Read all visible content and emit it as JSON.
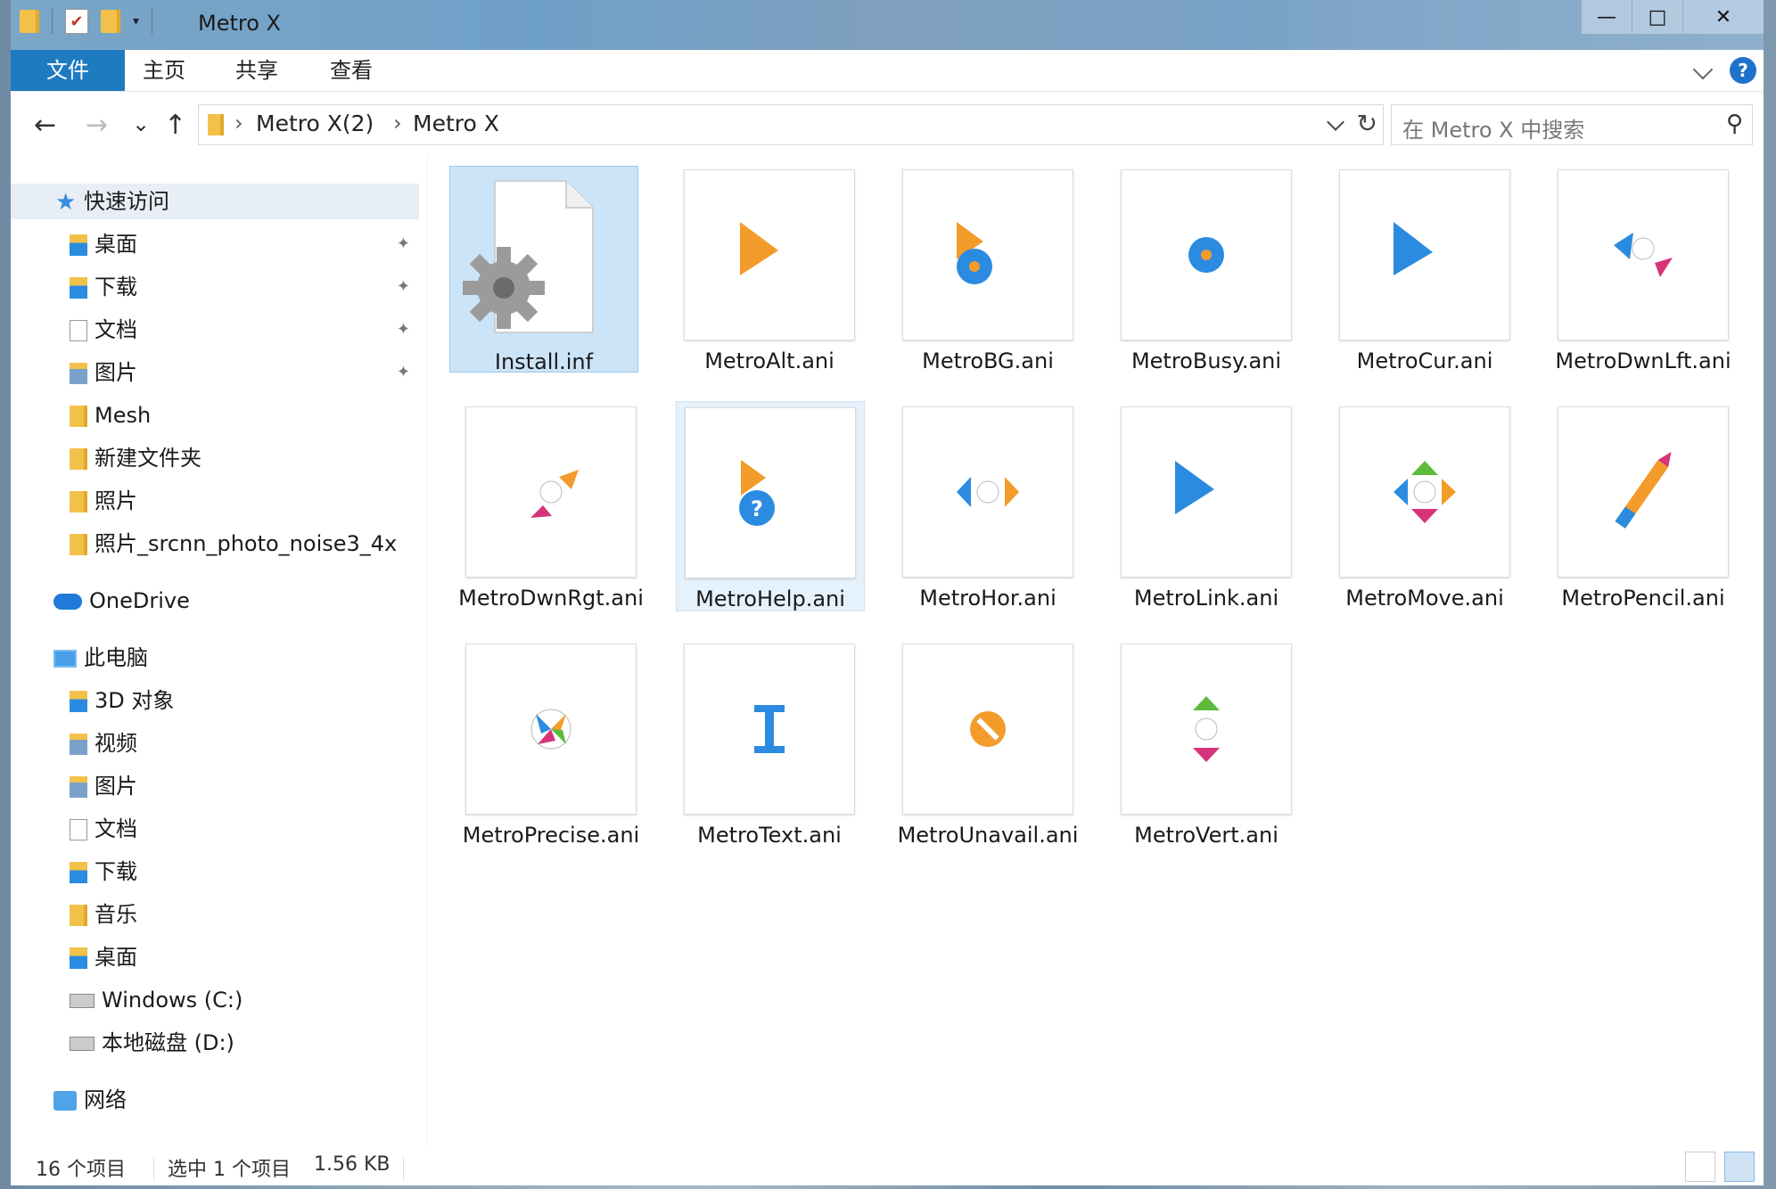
{
  "window": {
    "title": "Metro X"
  },
  "quick_access_toolbar": {
    "icons": [
      "folder-icon",
      "properties-icon",
      "new-folder-icon",
      "customize-icon"
    ]
  },
  "window_controls": {
    "minimize": "—",
    "maximize": "□",
    "close": "✕"
  },
  "ribbon": {
    "tabs": [
      {
        "label": "文件",
        "active": true
      },
      {
        "label": "主页"
      },
      {
        "label": "共享"
      },
      {
        "label": "查看"
      }
    ],
    "help": "?"
  },
  "nav": {
    "back": "←",
    "forward": "→",
    "recent": "⌄",
    "up": "↑",
    "breadcrumb": [
      "Metro X(2)",
      "Metro X"
    ],
    "refresh": "↻",
    "search_placeholder": "在 Metro X 中搜索",
    "search_icon": "⚲"
  },
  "sidebar": {
    "quick_access": "快速访问",
    "pinned": [
      "桌面",
      "下载",
      "文档",
      "图片"
    ],
    "recent": [
      "Mesh",
      "新建文件夹",
      "照片",
      "照片_srcnn_photo_noise3_4x"
    ],
    "onedrive": "OneDrive",
    "this_pc": "此电脑",
    "pc_items": [
      "3D 对象",
      "视频",
      "图片",
      "文档",
      "下载",
      "音乐",
      "桌面"
    ],
    "drives": [
      "Windows (C:)",
      "本地磁盘 (D:)"
    ],
    "network": "网络",
    "pin_glyph": "📌"
  },
  "files": [
    {
      "name": "Install.inf",
      "icon": "settings-file-icon",
      "state": "selected"
    },
    {
      "name": "MetroAlt.ani",
      "icon": "cursor-alt-icon"
    },
    {
      "name": "MetroBG.ani",
      "icon": "cursor-background-busy-icon"
    },
    {
      "name": "MetroBusy.ani",
      "icon": "cursor-busy-icon"
    },
    {
      "name": "MetroCur.ani",
      "icon": "cursor-arrow-icon"
    },
    {
      "name": "MetroDwnLft.ani",
      "icon": "cursor-diag-resize-left-icon"
    },
    {
      "name": "MetroDwnRgt.ani",
      "icon": "cursor-diag-resize-right-icon"
    },
    {
      "name": "MetroHelp.ani",
      "icon": "cursor-help-icon",
      "state": "hover"
    },
    {
      "name": "MetroHor.ani",
      "icon": "cursor-horizontal-resize-icon"
    },
    {
      "name": "MetroLink.ani",
      "icon": "cursor-link-icon"
    },
    {
      "name": "MetroMove.ani",
      "icon": "cursor-move-icon"
    },
    {
      "name": "MetroPencil.ani",
      "icon": "cursor-pencil-icon"
    },
    {
      "name": "MetroPrecise.ani",
      "icon": "cursor-precise-icon"
    },
    {
      "name": "MetroText.ani",
      "icon": "cursor-text-icon"
    },
    {
      "name": "MetroUnavail.ani",
      "icon": "cursor-unavailable-icon"
    },
    {
      "name": "MetroVert.ani",
      "icon": "cursor-vertical-resize-icon"
    }
  ],
  "status": {
    "count": "16 个项目",
    "selected": "选中 1 个项目",
    "size": "1.56 KB"
  },
  "colors": {
    "accent": "#1e7bbf",
    "orange": "#f39b2b",
    "blue": "#2b8be0",
    "pink": "#d6337a",
    "green": "#5dbb3c",
    "selection": "#cce4f7"
  }
}
